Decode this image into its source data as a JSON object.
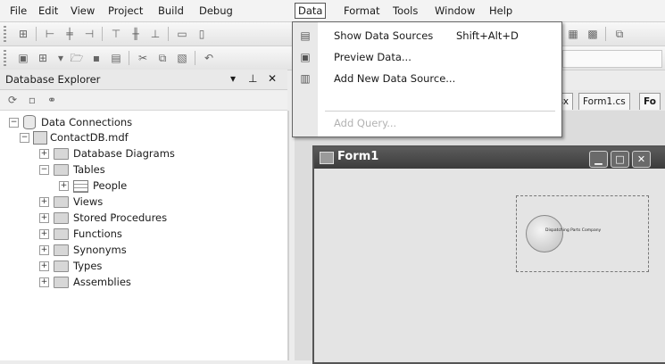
{
  "menubar": {
    "items": [
      "File",
      "Edit",
      "View",
      "Project",
      "Build",
      "Debug",
      "Data",
      "Format",
      "Tools",
      "Window",
      "Help"
    ],
    "active": "Data"
  },
  "data_menu": {
    "items": [
      {
        "label": "Show Data Sources",
        "shortcut": "Shift+Alt+D",
        "icon": "data-sources-icon",
        "enabled": true
      },
      {
        "label": "Preview Data...",
        "shortcut": "",
        "icon": "preview-icon",
        "enabled": true
      },
      {
        "label": "Add New Data Source...",
        "shortcut": "",
        "icon": "add-source-icon",
        "enabled": true
      },
      {
        "label": "Add Query...",
        "shortcut": "",
        "icon": "",
        "enabled": false
      }
    ]
  },
  "database_explorer": {
    "title": "Database Explorer",
    "pin_glyph": "▾ 𝟜 ✕",
    "tree": {
      "root": "Data Connections",
      "connection": "ContactDB.mdf",
      "children": [
        "Database Diagrams",
        "Tables",
        "Views",
        "Stored Procedures",
        "Functions",
        "Synonyms",
        "Types",
        "Assemblies"
      ],
      "tables": [
        "People"
      ]
    }
  },
  "doc_tabs": [
    "esx",
    "Form1.cs",
    "Fo"
  ],
  "designer": {
    "form_title": "Form1",
    "control_text": "Dispatching Parts Company"
  },
  "colors": {
    "menu_active_border": "#555555",
    "form_titlebar": "#4a4a4a"
  }
}
